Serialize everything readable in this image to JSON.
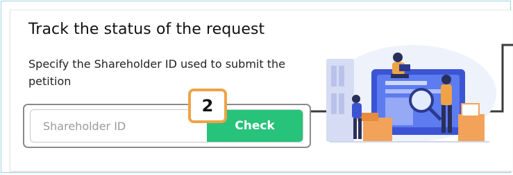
{
  "panel": {
    "title": "Track the status of the request",
    "subtitle": "Specify the Shareholder ID used to submit the petition"
  },
  "form": {
    "input_placeholder": "Shareholder ID",
    "input_value": "",
    "check_label": "Check"
  },
  "callout": {
    "step_number": "2"
  },
  "illustration": {
    "icon": "office-workers-illustration"
  },
  "colors": {
    "accent_green": "#27c37a",
    "badge_orange": "#f0a345",
    "frame_border": "#9fd2e2"
  }
}
